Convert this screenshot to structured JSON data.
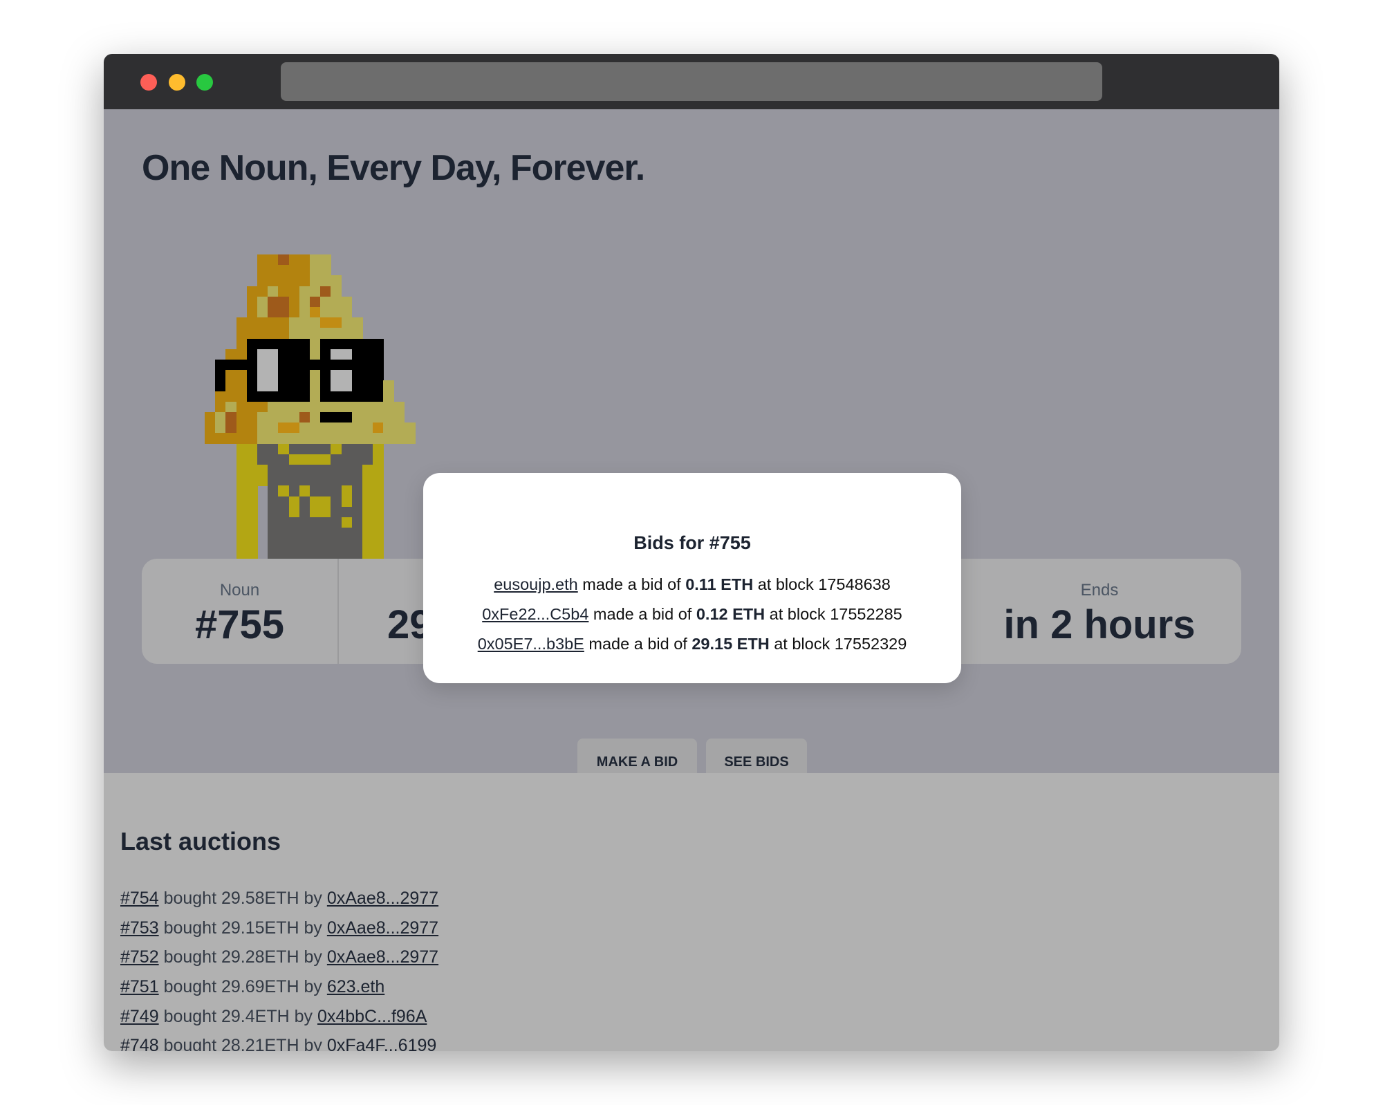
{
  "window": {
    "dots": [
      "#fe5f57",
      "#febc2e",
      "#28c840"
    ]
  },
  "hero": {
    "title": "One Noun, Every Day, Forever."
  },
  "noun_image": {
    "palette": {
      "O": "#b3830f",
      "o": "#c18c14",
      "Y": "#b3ac55",
      "B": "#9e5a1b",
      "K": "#000000",
      "W": "#b3b3b3",
      "T": "#b3a614",
      "G": "#5b5a59"
    }
  },
  "stats": {
    "noun_label": "Noun",
    "noun_value": "#755",
    "bid_partial": "29",
    "ends_label": "Ends",
    "ends_value": "in 2 hours"
  },
  "buttons": {
    "make_bid": "MAKE A BID",
    "see_bids": "SEE BIDS"
  },
  "modal": {
    "title": "Bids for #755",
    "bids": [
      {
        "bidder": "eusoujp.eth",
        "text1": " made a bid of ",
        "amount": "0.11 ETH",
        "text2": " at block ",
        "block": "17548638"
      },
      {
        "bidder": "0xFe22...C5b4",
        "text1": " made a bid of ",
        "amount": "0.12 ETH",
        "text2": " at block ",
        "block": "17552285"
      },
      {
        "bidder": "0x05E7...b3bE",
        "text1": " made a bid of ",
        "amount": "29.15 ETH",
        "text2": " at block ",
        "block": "17552329"
      }
    ]
  },
  "last_auctions": {
    "title": "Last auctions",
    "items": [
      {
        "noun": "#754",
        "text": " bought 29.58ETH by ",
        "buyer": "0xAae8...2977"
      },
      {
        "noun": "#753",
        "text": " bought 29.15ETH by ",
        "buyer": "0xAae8...2977"
      },
      {
        "noun": "#752",
        "text": " bought 29.28ETH by ",
        "buyer": "0xAae8...2977"
      },
      {
        "noun": "#751",
        "text": " bought 29.69ETH by ",
        "buyer": "623.eth"
      },
      {
        "noun": "#749",
        "text": " bought 29.4ETH by ",
        "buyer": "0x4bbC...f96A"
      },
      {
        "noun": "#748",
        "text": " bought 28.21ETH by ",
        "buyer": "0xFa4F...6199"
      }
    ]
  }
}
